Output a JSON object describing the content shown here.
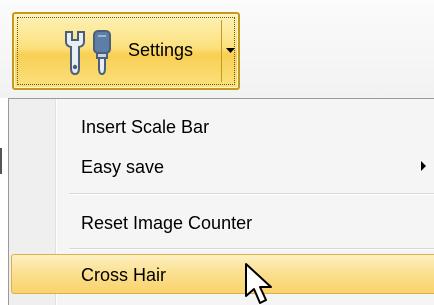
{
  "settings_button": {
    "label": "Settings",
    "icon": "wrench-settings-icon",
    "dropdown_icon": "dropdown-arrow-icon"
  },
  "menu": {
    "items": [
      {
        "label": "Insert Scale Bar",
        "has_submenu": false
      },
      {
        "label": "Easy save",
        "has_submenu": true
      },
      {
        "label": "Reset Image Counter",
        "has_submenu": false
      },
      {
        "label": "Cross Hair",
        "has_submenu": false,
        "highlighted": true
      }
    ]
  },
  "colors": {
    "button_border": "#c59a1c",
    "button_fill": "#fbe17e",
    "highlight_fill": "#fbdf8d",
    "menu_background": "#f5f5f5"
  },
  "cursor": {
    "icon": "mouse-pointer-icon"
  }
}
